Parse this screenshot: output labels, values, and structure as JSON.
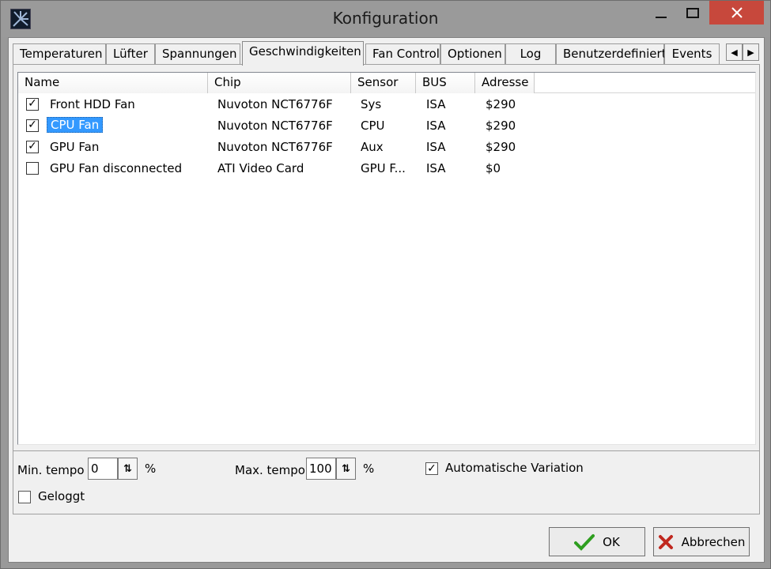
{
  "window": {
    "title": "Konfiguration"
  },
  "tabs": [
    {
      "label": "Temperaturen",
      "active": false
    },
    {
      "label": "Lüfter",
      "active": false
    },
    {
      "label": "Spannungen",
      "active": false
    },
    {
      "label": "Geschwindigkeiten",
      "active": true
    },
    {
      "label": "Fan Control",
      "active": false
    },
    {
      "label": "Optionen",
      "active": false
    },
    {
      "label": "Log",
      "active": false
    },
    {
      "label": "Benutzerdefiniert",
      "active": false
    },
    {
      "label": "Events",
      "active": false
    }
  ],
  "table": {
    "columns": [
      "Name",
      "Chip",
      "Sensor",
      "BUS",
      "Adresse"
    ],
    "rows": [
      {
        "checked": true,
        "name": "Front HDD Fan",
        "chip": "Nuvoton NCT6776F",
        "sensor": "Sys",
        "bus": "ISA",
        "address": "$290"
      },
      {
        "checked": true,
        "name": "CPU Fan",
        "chip": "Nuvoton NCT6776F",
        "sensor": "CPU",
        "bus": "ISA",
        "address": "$290",
        "selected": true
      },
      {
        "checked": true,
        "name": "GPU Fan",
        "chip": "Nuvoton NCT6776F",
        "sensor": "Aux",
        "bus": "ISA",
        "address": "$290"
      },
      {
        "checked": false,
        "name": "GPU Fan disconnected",
        "chip": "ATI Video Card",
        "sensor": "GPU F...",
        "bus": "ISA",
        "address": "$0"
      }
    ]
  },
  "controls": {
    "min_label": "Min. tempo",
    "min_value": "0",
    "min_unit": "%",
    "max_label": "Max. tempo",
    "max_value": "100",
    "max_unit": "%",
    "auto_label": "Automatische Variation",
    "auto_checked": true,
    "logged_label": "Geloggt",
    "logged_checked": false
  },
  "buttons": {
    "ok": "OK",
    "cancel": "Abbrechen"
  },
  "colors": {
    "selection": "#3399ff",
    "close_button": "#c7483c",
    "ok_check": "#2e9e1f",
    "cancel_x": "#c0281f"
  }
}
